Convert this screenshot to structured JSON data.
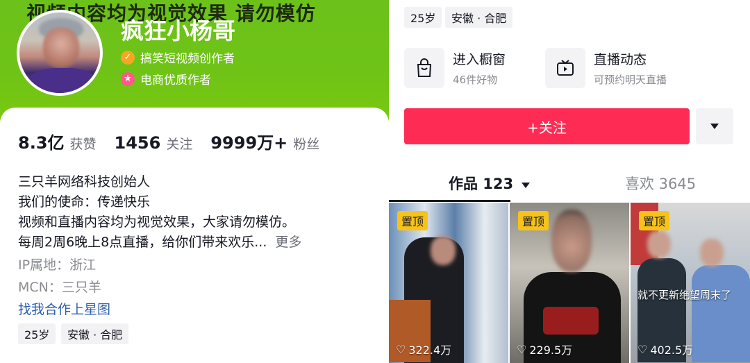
{
  "header": {
    "watermark": "视频内容均为视觉效果 请勿模仿",
    "nickname": "疯狂小杨哥",
    "badges": [
      {
        "icon": "check-badge-icon",
        "text": "搞笑短视频创作者"
      },
      {
        "icon": "star-badge-icon",
        "text": "电商优质作者"
      }
    ]
  },
  "stats": [
    {
      "value": "8.3亿",
      "label": "获赞"
    },
    {
      "value": "1456",
      "label": "关注"
    },
    {
      "value": "9999万+",
      "label": "粉丝"
    }
  ],
  "bio": {
    "lines": [
      "三只羊网络科技创始人",
      "我们的使命：传递快乐",
      "视频和直播内容均为视觉效果，大家请勿模仿。",
      "每周2周6晚上8点直播，给你们带来欢乐..."
    ],
    "more": "更多",
    "ip": "IP属地：浙江",
    "mcn": "MCN：三只羊",
    "cooperation_link": "找我合作上星图"
  },
  "tags": [
    "25岁",
    "安徽 · 合肥"
  ],
  "right_tags": [
    "25岁",
    "安徽 · 合肥"
  ],
  "features": [
    {
      "icon": "shopping-bag-icon",
      "title": "进入橱窗",
      "subtitle": "46件好物"
    },
    {
      "icon": "live-tv-icon",
      "title": "直播动态",
      "subtitle": "可预约明天直播"
    }
  ],
  "follow_label": "+关注",
  "tabs": {
    "works": "作品 123",
    "likes": "喜欢 3645"
  },
  "videos": [
    {
      "pin": "置顶",
      "plays": "322.4万",
      "caption": ""
    },
    {
      "pin": "置顶",
      "plays": "229.5万",
      "caption": ""
    },
    {
      "pin": "置顶",
      "plays": "402.5万",
      "caption": "就不更新绝望周末了"
    }
  ],
  "colors": {
    "brand_green": "#6fc317",
    "follow_red": "#fe2c55",
    "pin_yellow": "#f7c318",
    "link_blue": "#2a5db0"
  }
}
